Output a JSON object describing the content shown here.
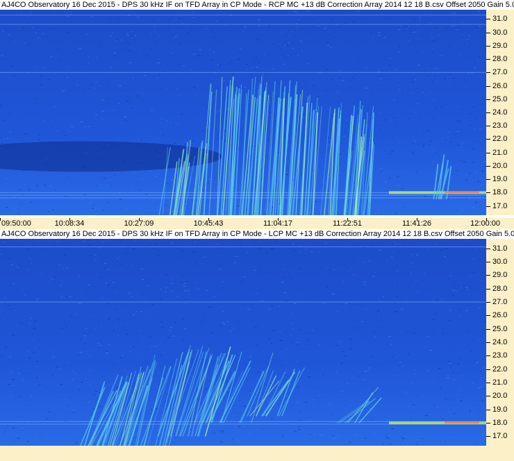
{
  "chart_data": [
    {
      "type": "heatmap",
      "title": "AJ4CO Observatory 16 Dec 2015 - DPS 30 kHz IF on TFD Array in CP Mode - RCP  MC +13 dB  Correction Array 2014 12 18 B.csv  Offset 2050  Gain 5.0",
      "x_ticks": [
        "09:50:00",
        "10:08:34",
        "10:27:09",
        "10:45:43",
        "11:04:17",
        "11:22:51",
        "11:41:26",
        "12:00:00"
      ],
      "y_ticks": [
        "31.0",
        "30.0",
        "29.0",
        "28.0",
        "27.0",
        "26.0",
        "25.0",
        "24.0",
        "23.0",
        "22.0",
        "21.0",
        "20.0",
        "19.0",
        "18.0",
        "17.0"
      ],
      "y_range": [
        16.3,
        31.7
      ],
      "xlabel": "",
      "ylabel": ""
    },
    {
      "type": "heatmap",
      "title": "AJ4CO Observatory 16 Dec 2015 - DPS 30 kHz IF on TFD Array in CP Mode - LCP  MC +13 dB  Correction Array 2014 12 18 B.csv  Offset 2050  Gain 5.0",
      "x_ticks": [],
      "y_ticks": [
        "31.0",
        "30.0",
        "29.0",
        "28.0",
        "27.0",
        "26.0",
        "25.0",
        "24.0",
        "23.0",
        "22.0",
        "21.0",
        "20.0",
        "19.0",
        "18.0",
        "17.0"
      ],
      "y_range": [
        16.3,
        31.7
      ],
      "xlabel": "",
      "ylabel": ""
    }
  ],
  "colors": {
    "background_blue": "#1a4fd6",
    "axis_bg": "#fbf0c8",
    "burst": "#6fe0f0"
  }
}
